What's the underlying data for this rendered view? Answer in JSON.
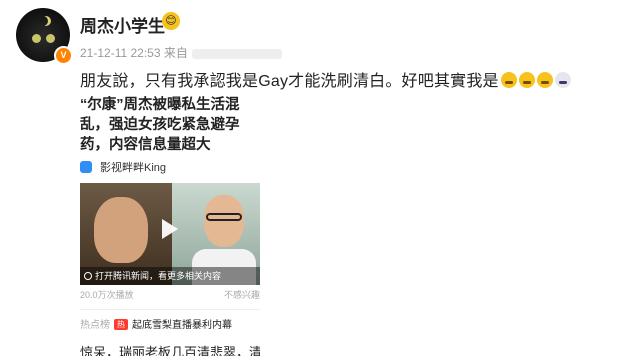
{
  "post": {
    "username": "周杰小学生",
    "verified_badge": "V",
    "timestamp": "21-12-11 22:53",
    "source_prefix": "来自",
    "text": "朋友說，只有我承認我是Gay才能洗刷清白。好吧其實我是",
    "trailing_emojis": [
      "crying-face-icon",
      "crying-face-icon",
      "crying-face-icon",
      "dog-face-icon"
    ]
  },
  "card": {
    "title": "“尔康”周杰被曝私生活混乱，强迫女孩吃紧急避孕药，内容信息量超大",
    "source_name": "影视畔畔King",
    "video_overlay_text": "打开腾讯新闻，看更多相关内容",
    "views": "20.0万次播放",
    "report_label": "不感兴趣",
    "hot_label": "热点榜",
    "hot_badge": "热",
    "hot_text": "起底雪梨直播暴利内幕",
    "bottom_text": "惊呆，瑞丽老板几百清悲翠，清"
  },
  "colors": {
    "accent": "#ff8200",
    "text": "#222222",
    "muted": "#999999"
  }
}
